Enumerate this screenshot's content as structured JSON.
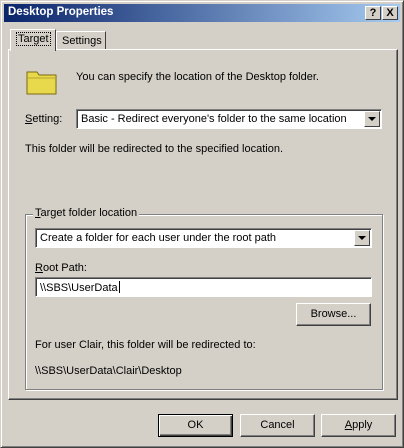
{
  "window": {
    "title": "Desktop Properties",
    "help_button": "?",
    "close_button": "X"
  },
  "tabs": [
    {
      "label": "Target",
      "active": true
    },
    {
      "label": "Settings",
      "active": false
    }
  ],
  "target_tab": {
    "description": "You can specify the location of the Desktop folder.",
    "setting_label": "Setting:",
    "setting_value": "Basic - Redirect everyone's folder to the same location",
    "redirect_note": "This folder will be redirected to the specified location.",
    "group_title": "Target folder location",
    "target_value": "Create a folder for each user under the root path",
    "root_path_label": "Root Path:",
    "root_path_value": "\\\\SBS\\UserData",
    "browse_label": "Browse...",
    "user_note": "For user Clair, this folder will be redirected to:",
    "resolved_path": "\\\\SBS\\UserData\\Clair\\Desktop"
  },
  "footer": {
    "ok_label": "OK",
    "cancel_label": "Cancel",
    "apply_label": "Apply"
  },
  "icons": {
    "folder": "folder-icon",
    "dropdown_arrow": "chevron-down-icon"
  },
  "colors": {
    "face": "#d4d0c8",
    "title_start": "#0a246a",
    "title_end": "#a6caf0",
    "folder": "#e8d84b"
  }
}
